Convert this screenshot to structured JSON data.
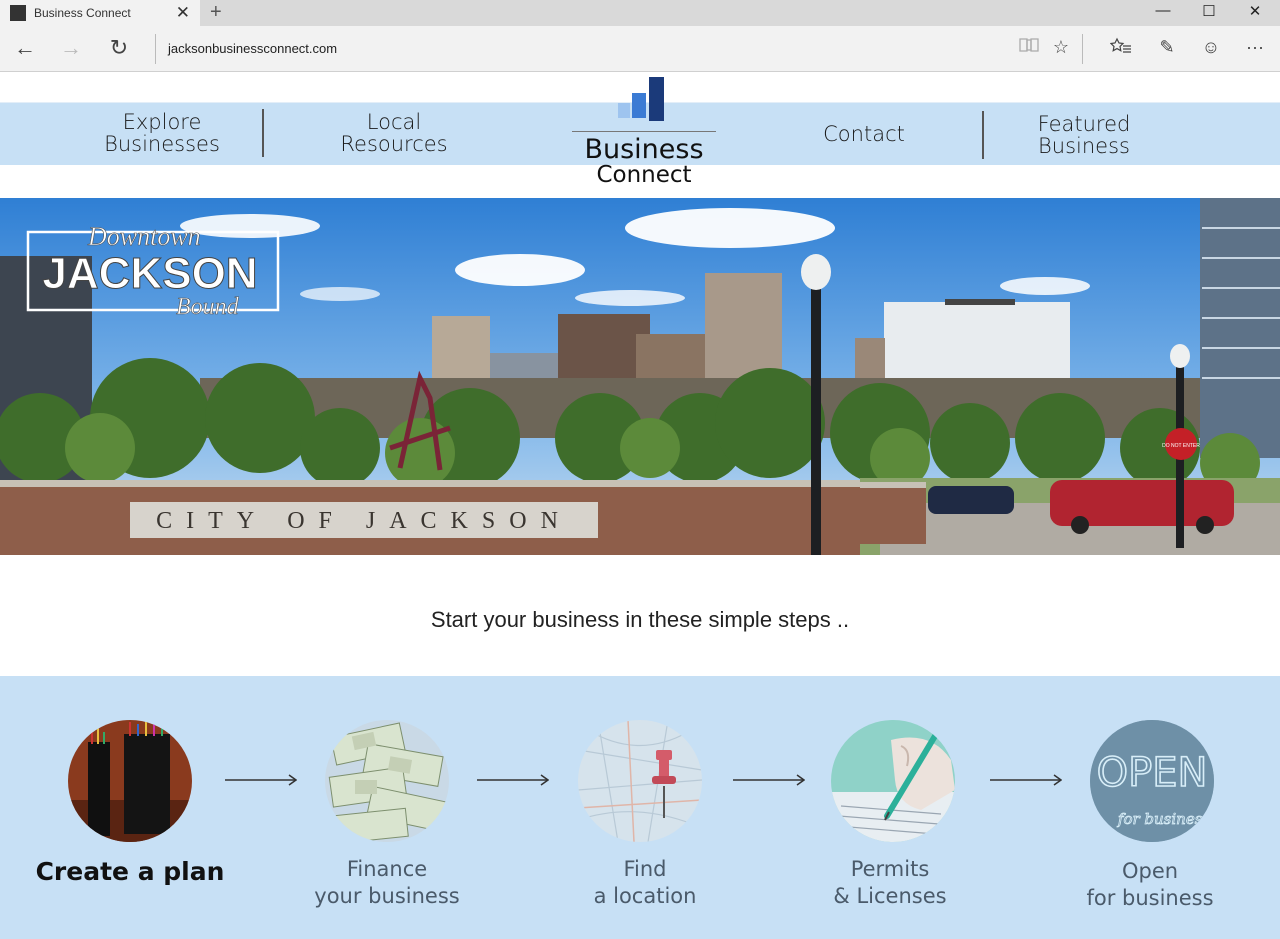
{
  "browser": {
    "tab_title": "Business Connect",
    "url": "jacksonbusinessconnect.com"
  },
  "icons": {
    "back": "←",
    "forward": "→",
    "refresh": "↻",
    "reading_view": "📖",
    "favorite": "☆",
    "hub": "☆≡",
    "note": "✎",
    "feedback": "☺",
    "more": "···",
    "close": "✕",
    "new_tab": "+",
    "minimize": "—",
    "maximize": "☐",
    "window_close": "✕"
  },
  "nav": {
    "explore_line1": "Explore",
    "explore_line2": "Businesses",
    "local_line1": "Local",
    "local_line2": "Resources",
    "contact": "Contact",
    "featured_line1": "Featured",
    "featured_line2": "Business"
  },
  "logo": {
    "line1": "Business",
    "line2": "Connect"
  },
  "hero": {
    "badge_top": "Downtown",
    "badge_main": "JACKSON",
    "badge_bottom": "Bound",
    "sign_text": "CITY OF JACKSON",
    "stop_sign": "DO NOT ENTER"
  },
  "tagline": "Start your business in these simple steps ..",
  "steps": [
    {
      "line1": "Create a plan",
      "line2": ""
    },
    {
      "line1": "Finance",
      "line2": "your business"
    },
    {
      "line1": "Find",
      "line2": "a location"
    },
    {
      "line1": "Permits",
      "line2": "& Licenses"
    },
    {
      "line1": "Open",
      "line2": "for business"
    }
  ],
  "step_open_sign": {
    "main": "OPEN",
    "sub": "for business"
  },
  "colors": {
    "nav_band": "#c7e0f5",
    "logo_dark": "#1b3a7a",
    "logo_mid": "#3b7bd4",
    "logo_light": "#9ec4ef"
  }
}
